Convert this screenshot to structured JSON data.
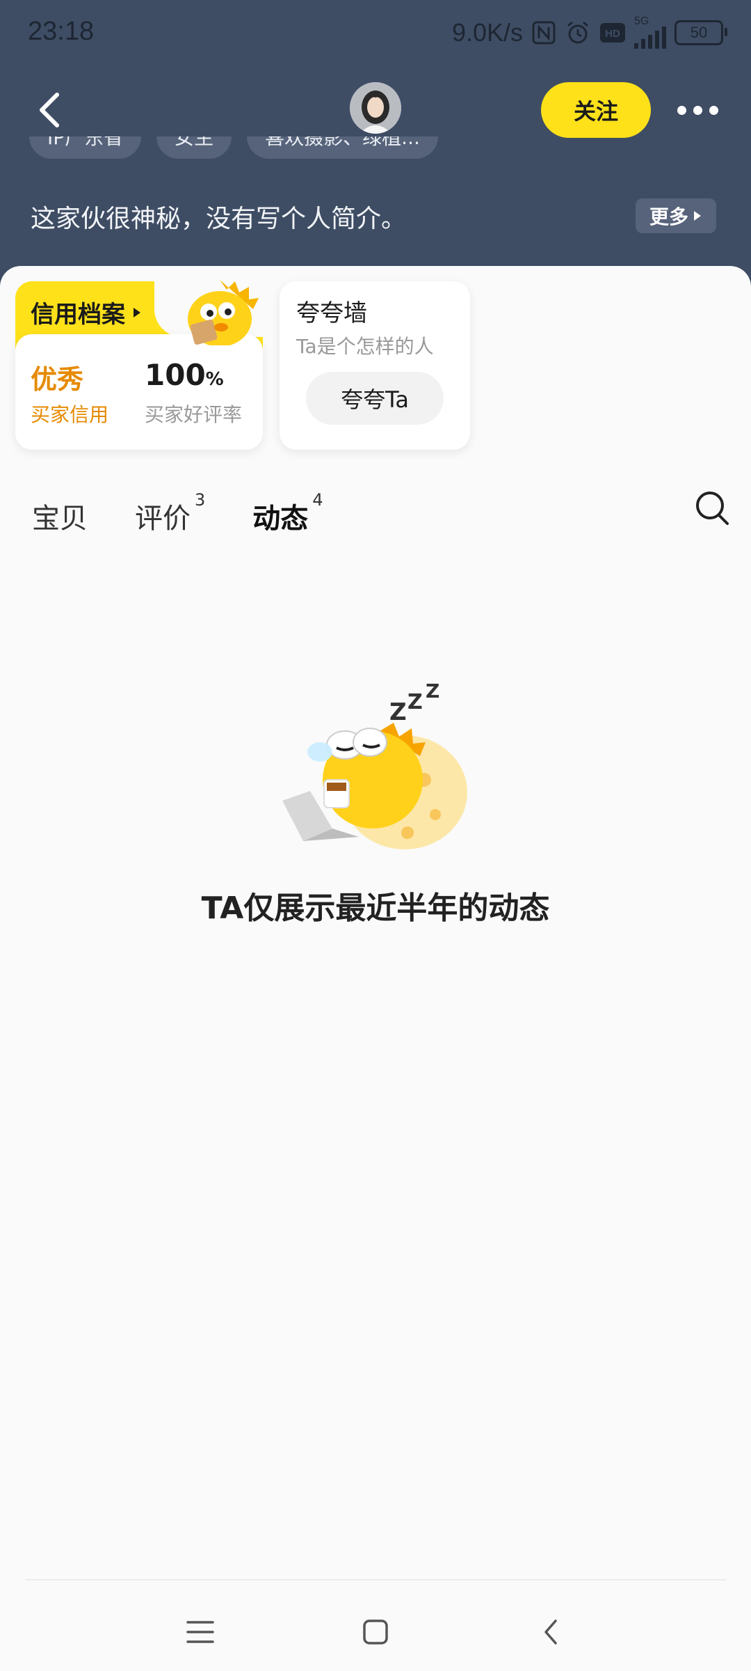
{
  "status_bar": {
    "time": "23:18",
    "net_speed": "9.0K/s",
    "battery": "50",
    "network_type": "5G",
    "hd_label": "HD",
    "icons": [
      "nfc-icon",
      "alarm-icon",
      "hd-icon",
      "signal-icon",
      "battery-icon"
    ]
  },
  "header": {
    "follow_label": "关注",
    "tags": [
      "IP广东省",
      "女生",
      "喜欢摄影、绿植..."
    ],
    "bio": "这家伙很神秘，没有写个人简介。",
    "more_label": "更多"
  },
  "credit_card": {
    "title": "信用档案",
    "rating_value": "优秀",
    "rating_label": "买家信用",
    "praise_rate_value": "100",
    "praise_rate_unit": "%",
    "praise_rate_label": "买家好评率"
  },
  "praise_wall": {
    "title": "夸夸墙",
    "subtitle": "Ta是个怎样的人",
    "button_label": "夸夸Ta"
  },
  "tabs": [
    {
      "label": "宝贝",
      "count": ""
    },
    {
      "label": "评价",
      "count": "3"
    },
    {
      "label": "动态",
      "count": "4",
      "active": true
    }
  ],
  "empty_state": {
    "message": "TA仅展示最近半年的动态"
  },
  "colors": {
    "header_bg": "#3e4d64",
    "accent_yellow": "#ffe11a",
    "credit_orange": "#e68a00"
  }
}
